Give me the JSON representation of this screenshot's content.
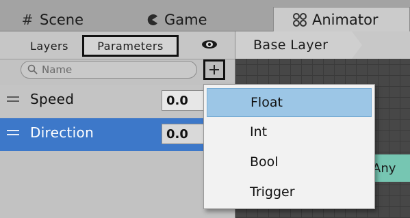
{
  "tabs": [
    {
      "label": "Scene",
      "icon": "grid-icon"
    },
    {
      "label": "Game",
      "icon": "pacman-icon"
    },
    {
      "label": "Animator",
      "icon": "animator-icon",
      "active": true
    }
  ],
  "left_panel": {
    "subtabs": {
      "layers": "Layers",
      "parameters": "Parameters"
    },
    "search": {
      "placeholder": "Name"
    },
    "parameters": [
      {
        "name": "Speed",
        "value": "0.0",
        "selected": false
      },
      {
        "name": "Direction",
        "value": "0.0",
        "selected": true
      }
    ]
  },
  "graph": {
    "breadcrumb": "Base Layer",
    "node_label": "Any"
  },
  "add_menu": {
    "items": [
      "Float",
      "Int",
      "Bool",
      "Trigger"
    ],
    "highlighted": "Float"
  },
  "colors": {
    "selection_blue": "#3d78c9",
    "menu_highlight": "#9cc6e6",
    "node_teal": "#76c6b2",
    "graph_bg": "#474747"
  }
}
